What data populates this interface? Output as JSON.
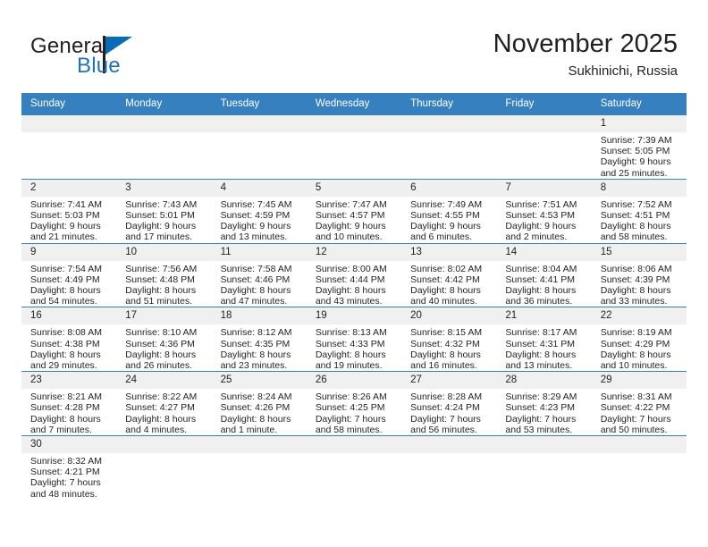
{
  "brand": {
    "name_top": "General",
    "name_bottom": "Blue",
    "accent_color": "#0a6cb4"
  },
  "header": {
    "title": "November 2025",
    "location": "Sukhinichi, Russia"
  },
  "theme": {
    "header_blue": "#3780c0",
    "daynum_band": "#f0f0f0",
    "text": "#231f20"
  },
  "weekday_headers": [
    "Sunday",
    "Monday",
    "Tuesday",
    "Wednesday",
    "Thursday",
    "Friday",
    "Saturday"
  ],
  "weeks": [
    [
      {
        "day": "",
        "lines": []
      },
      {
        "day": "",
        "lines": []
      },
      {
        "day": "",
        "lines": []
      },
      {
        "day": "",
        "lines": []
      },
      {
        "day": "",
        "lines": []
      },
      {
        "day": "",
        "lines": []
      },
      {
        "day": "1",
        "lines": [
          "Sunrise: 7:39 AM",
          "Sunset: 5:05 PM",
          "Daylight: 9 hours",
          "and 25 minutes."
        ]
      }
    ],
    [
      {
        "day": "2",
        "lines": [
          "Sunrise: 7:41 AM",
          "Sunset: 5:03 PM",
          "Daylight: 9 hours",
          "and 21 minutes."
        ]
      },
      {
        "day": "3",
        "lines": [
          "Sunrise: 7:43 AM",
          "Sunset: 5:01 PM",
          "Daylight: 9 hours",
          "and 17 minutes."
        ]
      },
      {
        "day": "4",
        "lines": [
          "Sunrise: 7:45 AM",
          "Sunset: 4:59 PM",
          "Daylight: 9 hours",
          "and 13 minutes."
        ]
      },
      {
        "day": "5",
        "lines": [
          "Sunrise: 7:47 AM",
          "Sunset: 4:57 PM",
          "Daylight: 9 hours",
          "and 10 minutes."
        ]
      },
      {
        "day": "6",
        "lines": [
          "Sunrise: 7:49 AM",
          "Sunset: 4:55 PM",
          "Daylight: 9 hours",
          "and 6 minutes."
        ]
      },
      {
        "day": "7",
        "lines": [
          "Sunrise: 7:51 AM",
          "Sunset: 4:53 PM",
          "Daylight: 9 hours",
          "and 2 minutes."
        ]
      },
      {
        "day": "8",
        "lines": [
          "Sunrise: 7:52 AM",
          "Sunset: 4:51 PM",
          "Daylight: 8 hours",
          "and 58 minutes."
        ]
      }
    ],
    [
      {
        "day": "9",
        "lines": [
          "Sunrise: 7:54 AM",
          "Sunset: 4:49 PM",
          "Daylight: 8 hours",
          "and 54 minutes."
        ]
      },
      {
        "day": "10",
        "lines": [
          "Sunrise: 7:56 AM",
          "Sunset: 4:48 PM",
          "Daylight: 8 hours",
          "and 51 minutes."
        ]
      },
      {
        "day": "11",
        "lines": [
          "Sunrise: 7:58 AM",
          "Sunset: 4:46 PM",
          "Daylight: 8 hours",
          "and 47 minutes."
        ]
      },
      {
        "day": "12",
        "lines": [
          "Sunrise: 8:00 AM",
          "Sunset: 4:44 PM",
          "Daylight: 8 hours",
          "and 43 minutes."
        ]
      },
      {
        "day": "13",
        "lines": [
          "Sunrise: 8:02 AM",
          "Sunset: 4:42 PM",
          "Daylight: 8 hours",
          "and 40 minutes."
        ]
      },
      {
        "day": "14",
        "lines": [
          "Sunrise: 8:04 AM",
          "Sunset: 4:41 PM",
          "Daylight: 8 hours",
          "and 36 minutes."
        ]
      },
      {
        "day": "15",
        "lines": [
          "Sunrise: 8:06 AM",
          "Sunset: 4:39 PM",
          "Daylight: 8 hours",
          "and 33 minutes."
        ]
      }
    ],
    [
      {
        "day": "16",
        "lines": [
          "Sunrise: 8:08 AM",
          "Sunset: 4:38 PM",
          "Daylight: 8 hours",
          "and 29 minutes."
        ]
      },
      {
        "day": "17",
        "lines": [
          "Sunrise: 8:10 AM",
          "Sunset: 4:36 PM",
          "Daylight: 8 hours",
          "and 26 minutes."
        ]
      },
      {
        "day": "18",
        "lines": [
          "Sunrise: 8:12 AM",
          "Sunset: 4:35 PM",
          "Daylight: 8 hours",
          "and 23 minutes."
        ]
      },
      {
        "day": "19",
        "lines": [
          "Sunrise: 8:13 AM",
          "Sunset: 4:33 PM",
          "Daylight: 8 hours",
          "and 19 minutes."
        ]
      },
      {
        "day": "20",
        "lines": [
          "Sunrise: 8:15 AM",
          "Sunset: 4:32 PM",
          "Daylight: 8 hours",
          "and 16 minutes."
        ]
      },
      {
        "day": "21",
        "lines": [
          "Sunrise: 8:17 AM",
          "Sunset: 4:31 PM",
          "Daylight: 8 hours",
          "and 13 minutes."
        ]
      },
      {
        "day": "22",
        "lines": [
          "Sunrise: 8:19 AM",
          "Sunset: 4:29 PM",
          "Daylight: 8 hours",
          "and 10 minutes."
        ]
      }
    ],
    [
      {
        "day": "23",
        "lines": [
          "Sunrise: 8:21 AM",
          "Sunset: 4:28 PM",
          "Daylight: 8 hours",
          "and 7 minutes."
        ]
      },
      {
        "day": "24",
        "lines": [
          "Sunrise: 8:22 AM",
          "Sunset: 4:27 PM",
          "Daylight: 8 hours",
          "and 4 minutes."
        ]
      },
      {
        "day": "25",
        "lines": [
          "Sunrise: 8:24 AM",
          "Sunset: 4:26 PM",
          "Daylight: 8 hours",
          "and 1 minute."
        ]
      },
      {
        "day": "26",
        "lines": [
          "Sunrise: 8:26 AM",
          "Sunset: 4:25 PM",
          "Daylight: 7 hours",
          "and 58 minutes."
        ]
      },
      {
        "day": "27",
        "lines": [
          "Sunrise: 8:28 AM",
          "Sunset: 4:24 PM",
          "Daylight: 7 hours",
          "and 56 minutes."
        ]
      },
      {
        "day": "28",
        "lines": [
          "Sunrise: 8:29 AM",
          "Sunset: 4:23 PM",
          "Daylight: 7 hours",
          "and 53 minutes."
        ]
      },
      {
        "day": "29",
        "lines": [
          "Sunrise: 8:31 AM",
          "Sunset: 4:22 PM",
          "Daylight: 7 hours",
          "and 50 minutes."
        ]
      }
    ],
    [
      {
        "day": "30",
        "lines": [
          "Sunrise: 8:32 AM",
          "Sunset: 4:21 PM",
          "Daylight: 7 hours",
          "and 48 minutes."
        ]
      },
      {
        "day": "",
        "lines": []
      },
      {
        "day": "",
        "lines": []
      },
      {
        "day": "",
        "lines": []
      },
      {
        "day": "",
        "lines": []
      },
      {
        "day": "",
        "lines": []
      },
      {
        "day": "",
        "lines": []
      }
    ]
  ]
}
